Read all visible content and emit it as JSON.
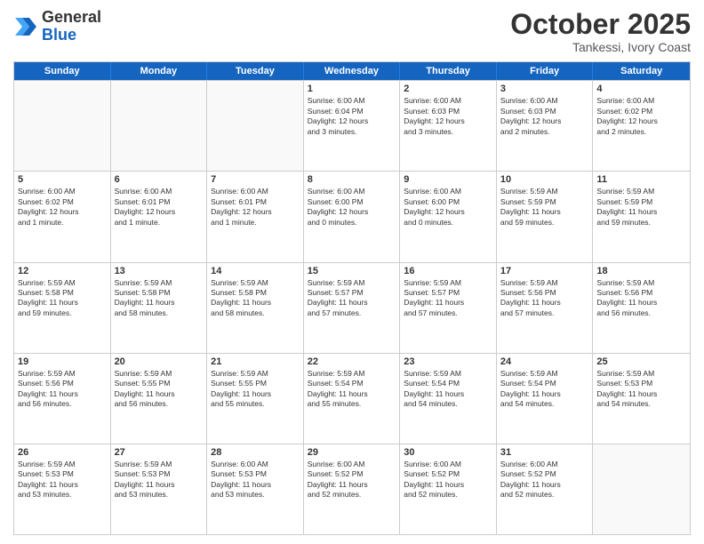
{
  "header": {
    "logo": {
      "general": "General",
      "blue": "Blue"
    },
    "month": "October 2025",
    "location": "Tankessi, Ivory Coast"
  },
  "weekdays": [
    "Sunday",
    "Monday",
    "Tuesday",
    "Wednesday",
    "Thursday",
    "Friday",
    "Saturday"
  ],
  "weeks": [
    [
      {
        "day": "",
        "info": ""
      },
      {
        "day": "",
        "info": ""
      },
      {
        "day": "",
        "info": ""
      },
      {
        "day": "1",
        "info": "Sunrise: 6:00 AM\nSunset: 6:04 PM\nDaylight: 12 hours\nand 3 minutes."
      },
      {
        "day": "2",
        "info": "Sunrise: 6:00 AM\nSunset: 6:03 PM\nDaylight: 12 hours\nand 3 minutes."
      },
      {
        "day": "3",
        "info": "Sunrise: 6:00 AM\nSunset: 6:03 PM\nDaylight: 12 hours\nand 2 minutes."
      },
      {
        "day": "4",
        "info": "Sunrise: 6:00 AM\nSunset: 6:02 PM\nDaylight: 12 hours\nand 2 minutes."
      }
    ],
    [
      {
        "day": "5",
        "info": "Sunrise: 6:00 AM\nSunset: 6:02 PM\nDaylight: 12 hours\nand 1 minute."
      },
      {
        "day": "6",
        "info": "Sunrise: 6:00 AM\nSunset: 6:01 PM\nDaylight: 12 hours\nand 1 minute."
      },
      {
        "day": "7",
        "info": "Sunrise: 6:00 AM\nSunset: 6:01 PM\nDaylight: 12 hours\nand 1 minute."
      },
      {
        "day": "8",
        "info": "Sunrise: 6:00 AM\nSunset: 6:00 PM\nDaylight: 12 hours\nand 0 minutes."
      },
      {
        "day": "9",
        "info": "Sunrise: 6:00 AM\nSunset: 6:00 PM\nDaylight: 12 hours\nand 0 minutes."
      },
      {
        "day": "10",
        "info": "Sunrise: 5:59 AM\nSunset: 5:59 PM\nDaylight: 11 hours\nand 59 minutes."
      },
      {
        "day": "11",
        "info": "Sunrise: 5:59 AM\nSunset: 5:59 PM\nDaylight: 11 hours\nand 59 minutes."
      }
    ],
    [
      {
        "day": "12",
        "info": "Sunrise: 5:59 AM\nSunset: 5:58 PM\nDaylight: 11 hours\nand 59 minutes."
      },
      {
        "day": "13",
        "info": "Sunrise: 5:59 AM\nSunset: 5:58 PM\nDaylight: 11 hours\nand 58 minutes."
      },
      {
        "day": "14",
        "info": "Sunrise: 5:59 AM\nSunset: 5:58 PM\nDaylight: 11 hours\nand 58 minutes."
      },
      {
        "day": "15",
        "info": "Sunrise: 5:59 AM\nSunset: 5:57 PM\nDaylight: 11 hours\nand 57 minutes."
      },
      {
        "day": "16",
        "info": "Sunrise: 5:59 AM\nSunset: 5:57 PM\nDaylight: 11 hours\nand 57 minutes."
      },
      {
        "day": "17",
        "info": "Sunrise: 5:59 AM\nSunset: 5:56 PM\nDaylight: 11 hours\nand 57 minutes."
      },
      {
        "day": "18",
        "info": "Sunrise: 5:59 AM\nSunset: 5:56 PM\nDaylight: 11 hours\nand 56 minutes."
      }
    ],
    [
      {
        "day": "19",
        "info": "Sunrise: 5:59 AM\nSunset: 5:56 PM\nDaylight: 11 hours\nand 56 minutes."
      },
      {
        "day": "20",
        "info": "Sunrise: 5:59 AM\nSunset: 5:55 PM\nDaylight: 11 hours\nand 56 minutes."
      },
      {
        "day": "21",
        "info": "Sunrise: 5:59 AM\nSunset: 5:55 PM\nDaylight: 11 hours\nand 55 minutes."
      },
      {
        "day": "22",
        "info": "Sunrise: 5:59 AM\nSunset: 5:54 PM\nDaylight: 11 hours\nand 55 minutes."
      },
      {
        "day": "23",
        "info": "Sunrise: 5:59 AM\nSunset: 5:54 PM\nDaylight: 11 hours\nand 54 minutes."
      },
      {
        "day": "24",
        "info": "Sunrise: 5:59 AM\nSunset: 5:54 PM\nDaylight: 11 hours\nand 54 minutes."
      },
      {
        "day": "25",
        "info": "Sunrise: 5:59 AM\nSunset: 5:53 PM\nDaylight: 11 hours\nand 54 minutes."
      }
    ],
    [
      {
        "day": "26",
        "info": "Sunrise: 5:59 AM\nSunset: 5:53 PM\nDaylight: 11 hours\nand 53 minutes."
      },
      {
        "day": "27",
        "info": "Sunrise: 5:59 AM\nSunset: 5:53 PM\nDaylight: 11 hours\nand 53 minutes."
      },
      {
        "day": "28",
        "info": "Sunrise: 6:00 AM\nSunset: 5:53 PM\nDaylight: 11 hours\nand 53 minutes."
      },
      {
        "day": "29",
        "info": "Sunrise: 6:00 AM\nSunset: 5:52 PM\nDaylight: 11 hours\nand 52 minutes."
      },
      {
        "day": "30",
        "info": "Sunrise: 6:00 AM\nSunset: 5:52 PM\nDaylight: 11 hours\nand 52 minutes."
      },
      {
        "day": "31",
        "info": "Sunrise: 6:00 AM\nSunset: 5:52 PM\nDaylight: 11 hours\nand 52 minutes."
      },
      {
        "day": "",
        "info": ""
      }
    ]
  ]
}
